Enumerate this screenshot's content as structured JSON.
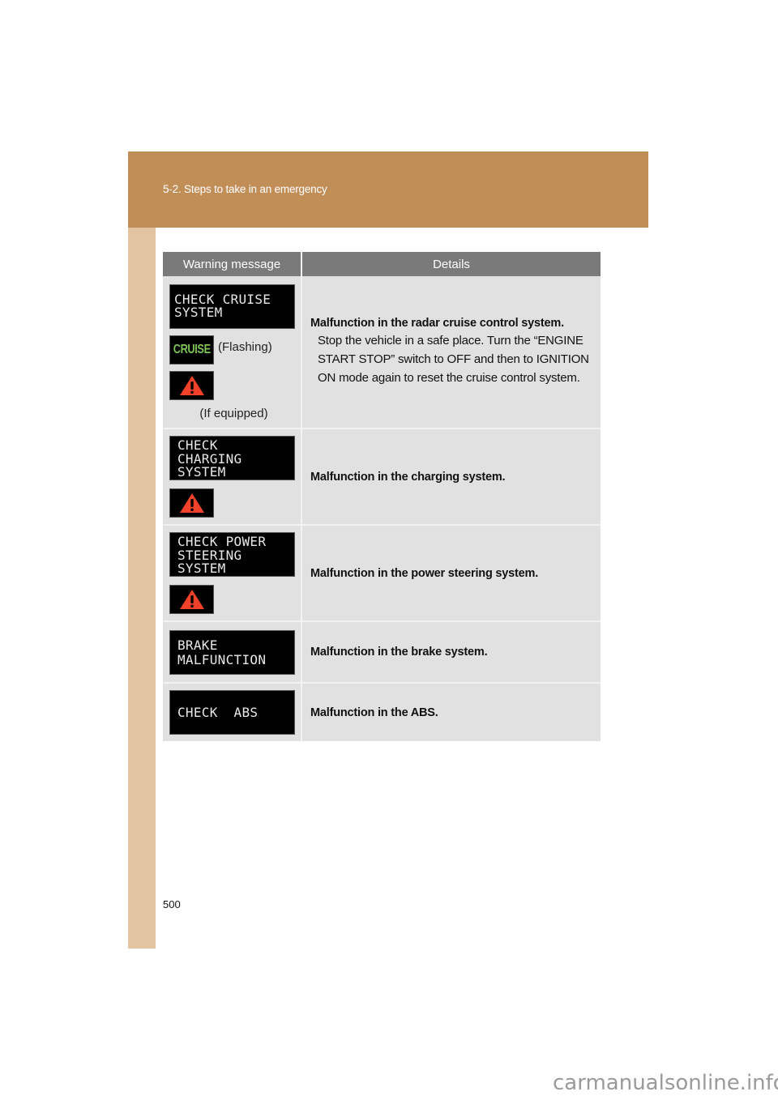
{
  "header": {
    "section_title": "5-2. Steps to take in an emergency"
  },
  "table": {
    "columns": [
      "Warning message",
      "Details"
    ],
    "rows": [
      {
        "display_text": "CHECK CRUISE\nSYSTEM",
        "indicator_lamp": "CRUISE",
        "indicator_note": "(Flashing)",
        "icon": "master-warning-triangle-icon",
        "icon_note": "(If equipped)",
        "detail_title": "Malfunction in the radar cruise control system.",
        "detail_body": "Stop the vehicle in a safe place. Turn the “ENGINE START STOP” switch to OFF and then to IGNITION ON mode again to reset the cruise control system."
      },
      {
        "display_text": "CHECK\nCHARGING\nSYSTEM",
        "icon": "master-warning-triangle-icon",
        "detail_title": "Malfunction in the charging system."
      },
      {
        "display_text": "CHECK POWER\nSTEERING\nSYSTEM",
        "icon": "master-warning-triangle-icon",
        "detail_title": "Malfunction in the power steering system."
      },
      {
        "display_text": "BRAKE\nMALFUNCTION",
        "detail_title": "Malfunction in the brake system."
      },
      {
        "display_text": "CHECK  ABS",
        "detail_title": "Malfunction in the ABS."
      }
    ]
  },
  "colors": {
    "header_band": "#c18e58",
    "side_strip": "#e2c4a2",
    "table_header": "#7a7a7a",
    "table_cell": "#e1e1e1",
    "cruise_lamp": "#7cc253",
    "warning_triangle": "#f0412a"
  },
  "footer": {
    "page_number": "500",
    "watermark": "carmanualsonline.info"
  }
}
